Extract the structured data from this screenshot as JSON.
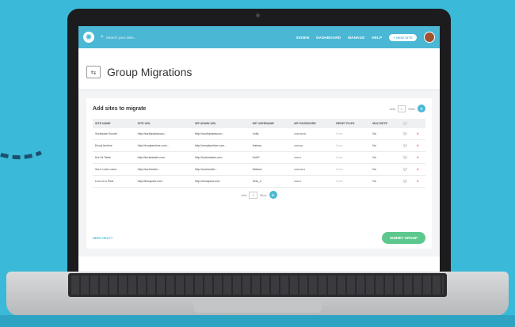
{
  "topbar": {
    "search_placeholder": "Search your sites...",
    "nav": [
      "SIGNIN",
      "DASHBOARD",
      "MANAGE",
      "HELP"
    ],
    "add_button": "+ NEW SITE"
  },
  "page": {
    "title": "Group Migrations"
  },
  "form": {
    "heading": "Add sites to migrate",
    "add_label": "Add",
    "add_count": "1",
    "add_suffix": "Sites",
    "columns": [
      "SITE NAME",
      "SITE URL",
      "WP ADMIN URL",
      "WP USERNAME",
      "WP PASSWORD",
      "RESET FILES",
      "MULTISITE"
    ],
    "rows": [
      {
        "name": "Southpaw Scoots",
        "url": "http://southpawsscoo...",
        "admin": "http://southpawsscoo...",
        "user": "Lefty",
        "pass": "••••••••••••",
        "reset": "None",
        "multi": "No"
      },
      {
        "name": "Emoji Archive",
        "url": "http://emojiarchive.com...",
        "admin": "http://emojiarchive.com...",
        "user": "Harkey",
        "pass": "•••••••••",
        "reset": "None",
        "multi": "No"
      },
      {
        "name": "Kurt N Taste",
        "url": "http://kurtsntaste.com",
        "admin": "http://kurtsntaste.com",
        "user": "KurtP",
        "pass": "•••••••",
        "reset": "None",
        "multi": "No"
      },
      {
        "name": "Sure Look Loans",
        "url": "http://surelooklo...",
        "admin": "http://surelooklo...",
        "user": "Watson",
        "pass": "•••••••••••",
        "reset": "None",
        "multi": "No"
      },
      {
        "name": "Lion on a Pear",
        "url": "http://lionapear.com",
        "admin": "http://lionapear.com",
        "user": "Zeto_2",
        "pass": "•••••••",
        "reset": "None",
        "multi": "No"
      }
    ],
    "bottom_add_label": "Add",
    "bottom_add_count": "1",
    "bottom_add_suffix": "Sites",
    "need_help": "NEED HELP?",
    "submit": "SUBMIT GROUP"
  }
}
